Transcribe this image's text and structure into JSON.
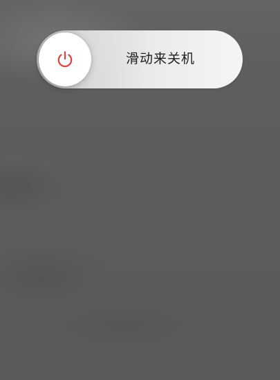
{
  "power_slider": {
    "label": "滑动来关机",
    "knob_icon": "power-icon",
    "colors": {
      "icon": "#e0403a",
      "track": "#f0f0f0",
      "knob": "#ffffff",
      "background": "#5d5d5d",
      "label": "#1f1f1f"
    }
  }
}
